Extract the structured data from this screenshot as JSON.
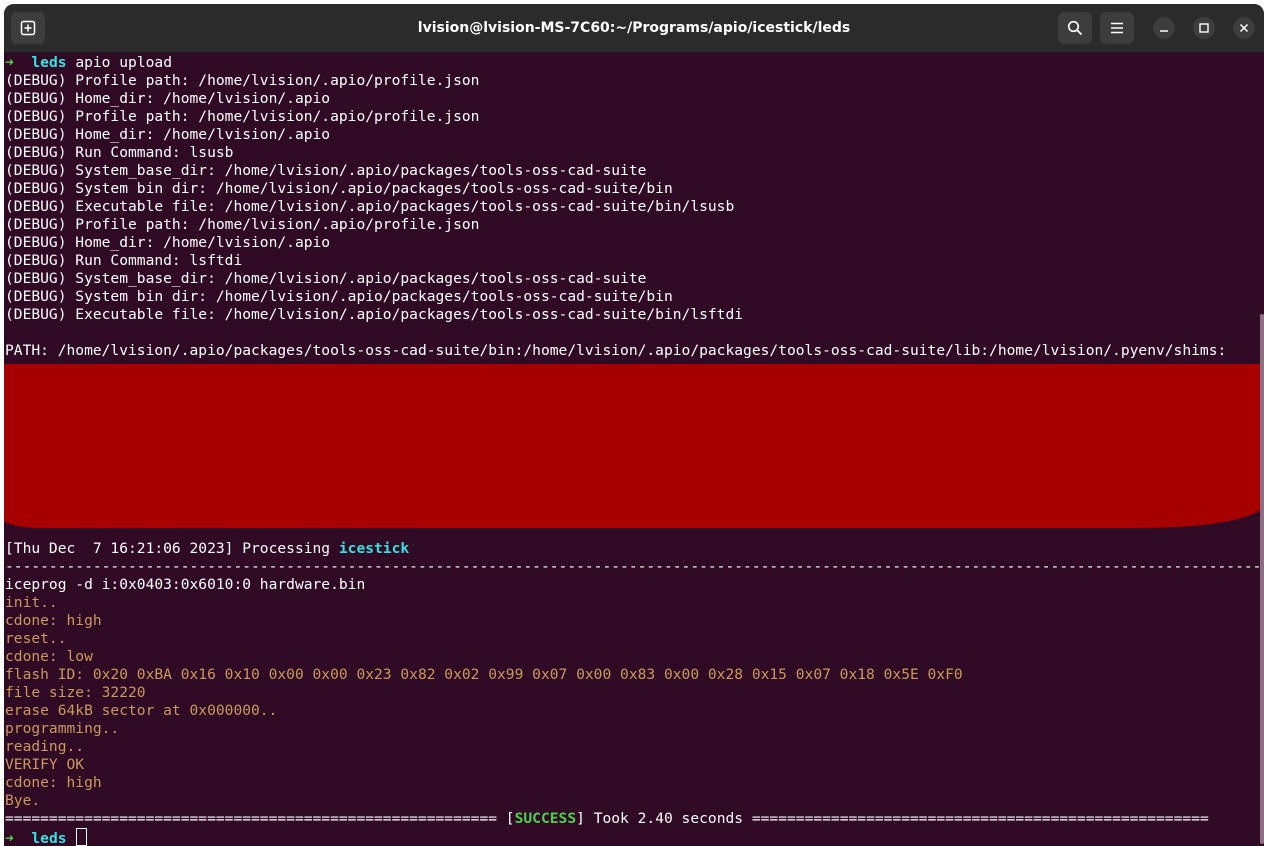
{
  "window": {
    "title": "lvision@lvision-MS-7C60:~/Programs/apio/icestick/leds"
  },
  "titlebar": {
    "new_tab_icon": "new-tab-icon",
    "search_icon": "search-icon",
    "menu_icon": "hamburger-menu-icon",
    "minimize_icon": "minimize-icon",
    "maximize_icon": "maximize-icon",
    "close_icon": "close-icon"
  },
  "terminal": {
    "prompt_arrow": "➜",
    "prompt_dir": "leds",
    "command": "apio upload",
    "debug_lines": [
      "(DEBUG) Profile path: /home/lvision/.apio/profile.json",
      "(DEBUG) Home_dir: /home/lvision/.apio",
      "(DEBUG) Profile path: /home/lvision/.apio/profile.json",
      "(DEBUG) Home_dir: /home/lvision/.apio",
      "(DEBUG) Run Command: lsusb",
      "(DEBUG) System_base_dir: /home/lvision/.apio/packages/tools-oss-cad-suite",
      "(DEBUG) System bin dir: /home/lvision/.apio/packages/tools-oss-cad-suite/bin",
      "(DEBUG) Executable file: /home/lvision/.apio/packages/tools-oss-cad-suite/bin/lsusb",
      "(DEBUG) Profile path: /home/lvision/.apio/profile.json",
      "(DEBUG) Home_dir: /home/lvision/.apio",
      "(DEBUG) Run Command: lsftdi",
      "(DEBUG) System_base_dir: /home/lvision/.apio/packages/tools-oss-cad-suite",
      "(DEBUG) System bin dir: /home/lvision/.apio/packages/tools-oss-cad-suite/bin",
      "(DEBUG) Executable file: /home/lvision/.apio/packages/tools-oss-cad-suite/bin/lsftdi"
    ],
    "path_line": "PATH: /home/lvision/.apio/packages/tools-oss-cad-suite/bin:/home/lvision/.apio/packages/tools-oss-cad-suite/lib:/home/lvision/.pyenv/shims:",
    "processing_prefix": "[Thu Dec  7 16:21:06 2023] Processing ",
    "processing_board": "icestick",
    "separator_dash": "-----------------------------------------------------------------------------------------------------------------------------------------------",
    "iceprog_command": "iceprog -d i:0x0403:0x6010:0 hardware.bin",
    "iceprog_output": [
      "init..",
      "cdone: high",
      "reset..",
      "cdone: low",
      "flash ID: 0x20 0xBA 0x16 0x10 0x00 0x00 0x23 0x82 0x02 0x99 0x07 0x00 0x83 0x00 0x28 0x15 0x07 0x18 0x5E 0xF0",
      "file size: 32220",
      "erase 64kB sector at 0x000000..",
      "programming..",
      "reading..",
      "VERIFY OK",
      "cdone: high",
      "Bye."
    ],
    "success_left": "======================================================== [",
    "success_word": "SUCCESS",
    "success_right": "] Took 2.40 seconds ====================================================",
    "final_prompt_arrow": "➜",
    "final_prompt_dir": "leds"
  },
  "colors": {
    "background": "#300a24",
    "titlebar": "#2b2b2b",
    "prompt_green": "#4bd14b",
    "cyan": "#34e2e2",
    "output_tan": "#c89a5e",
    "redaction": "#a70000"
  }
}
